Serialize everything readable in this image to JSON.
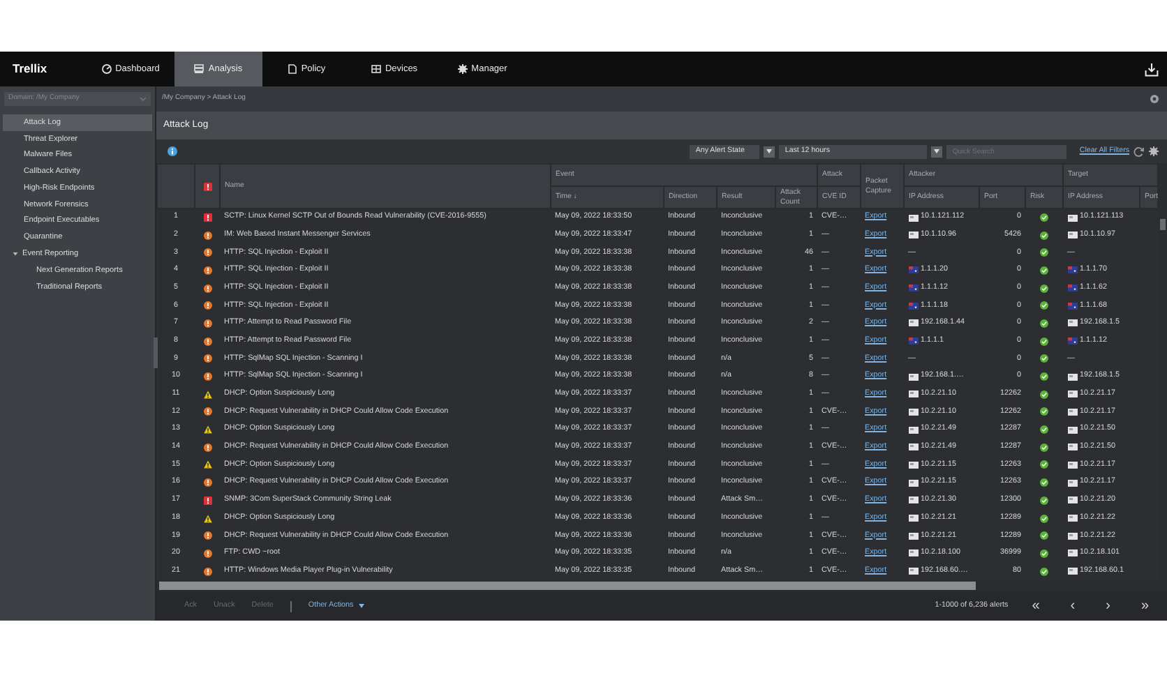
{
  "nav": {
    "logo": "Trellix",
    "tabs": [
      {
        "label": "Dashboard",
        "selected": false
      },
      {
        "label": "Analysis",
        "selected": true
      },
      {
        "label": "Policy",
        "selected": false
      },
      {
        "label": "Devices",
        "selected": false
      },
      {
        "label": "Manager",
        "selected": false
      }
    ]
  },
  "sidebar": {
    "domain_select": "Domain: /My Company",
    "items": [
      {
        "label": "Attack Log",
        "selected": true
      },
      {
        "label": "Threat Explorer",
        "selected": false
      },
      {
        "label": "Malware Files",
        "selected": false
      },
      {
        "label": "Callback Activity",
        "selected": false
      },
      {
        "label": "High-Risk Endpoints",
        "selected": false
      },
      {
        "label": "Network Forensics",
        "selected": false
      },
      {
        "label": "Endpoint Executables",
        "selected": false
      },
      {
        "label": "Quarantine",
        "selected": false
      },
      {
        "label": "Event Reporting",
        "selected": false,
        "expanded": true,
        "children": [
          {
            "label": "Next Generation Reports",
            "selected": false
          },
          {
            "label": "Traditional Reports",
            "selected": false
          }
        ]
      }
    ]
  },
  "breadcrumb": "/My Company > Attack Log",
  "title": "Attack Log",
  "toolbar": {
    "alert_state": "Any Alert State",
    "time_range": "Last 12 hours",
    "search_placeholder": "Quick Search",
    "clear_filters": "Clear All Filters"
  },
  "table": {
    "header": [
      {
        "kind": "single",
        "label": "Name"
      },
      {
        "kind": "group",
        "label": "Event",
        "columns": [
          "Time ↓",
          "Direction",
          "Result",
          "Attack Count"
        ]
      },
      {
        "kind": "group",
        "label": "Attack",
        "columns": [
          "CVE ID"
        ]
      },
      {
        "kind": "single",
        "label": "Packet Capture"
      },
      {
        "kind": "group",
        "label": "Attacker",
        "columns": [
          "IP Address",
          "Port",
          "Risk"
        ]
      },
      {
        "kind": "group",
        "label": "Target",
        "columns": [
          "IP Address",
          "Port"
        ]
      }
    ],
    "rows": [
      {
        "num": "1",
        "severity": {
          "kind": "high"
        },
        "name": "SCTP: Linux Kernel SCTP Out of Bounds Read Vulnerability (CVE-2016-9555)",
        "time": "May 09, 2022 18:33:50",
        "direction": "Inbound",
        "result": "Inconclusive",
        "attack_count": "1",
        "cve_id": "CVE-…",
        "packet_capture": "Export",
        "attacker_ip": "10.1.121.112",
        "attacker_flag": {
          "kind": "generic"
        },
        "attacker_port": "0",
        "target_ip": "10.1.121.113",
        "target_flag": {
          "kind": "generic"
        }
      },
      {
        "num": "2",
        "severity": {
          "kind": "medium"
        },
        "name": "IM: Web Based Instant Messenger Services",
        "time": "May 09, 2022 18:33:47",
        "direction": "Inbound",
        "result": "Inconclusive",
        "attack_count": "1",
        "cve_id": "—",
        "packet_capture": "Export",
        "attacker_ip": "10.1.10.96",
        "attacker_flag": {
          "kind": "generic"
        },
        "attacker_port": "5426",
        "target_ip": "10.1.10.97",
        "target_flag": {
          "kind": "generic"
        }
      },
      {
        "num": "3",
        "severity": {
          "kind": "medium"
        },
        "name": "HTTP: SQL Injection - Exploit II",
        "time": "May 09, 2022 18:33:38",
        "direction": "Inbound",
        "result": "Inconclusive",
        "attack_count": "46",
        "cve_id": "—",
        "packet_capture": "Export",
        "attacker_ip": "—",
        "attacker_port": "0",
        "target_ip": "—"
      },
      {
        "num": "4",
        "severity": {
          "kind": "medium"
        },
        "name": "HTTP: SQL Injection - Exploit II",
        "time": "May 09, 2022 18:33:38",
        "direction": "Inbound",
        "result": "Inconclusive",
        "attack_count": "1",
        "cve_id": "—",
        "packet_capture": "Export",
        "attacker_ip": "1.1.1.20",
        "attacker_flag": {
          "kind": "au"
        },
        "attacker_port": "0",
        "target_ip": "1.1.1.70",
        "target_flag": {
          "kind": "au"
        }
      },
      {
        "num": "5",
        "severity": {
          "kind": "medium"
        },
        "name": "HTTP: SQL Injection - Exploit II",
        "time": "May 09, 2022 18:33:38",
        "direction": "Inbound",
        "result": "Inconclusive",
        "attack_count": "1",
        "cve_id": "—",
        "packet_capture": "Export",
        "attacker_ip": "1.1.1.12",
        "attacker_flag": {
          "kind": "au"
        },
        "attacker_port": "0",
        "target_ip": "1.1.1.62",
        "target_flag": {
          "kind": "au"
        }
      },
      {
        "num": "6",
        "severity": {
          "kind": "medium"
        },
        "name": "HTTP: SQL Injection - Exploit II",
        "time": "May 09, 2022 18:33:38",
        "direction": "Inbound",
        "result": "Inconclusive",
        "attack_count": "1",
        "cve_id": "—",
        "packet_capture": "Export",
        "attacker_ip": "1.1.1.18",
        "attacker_flag": {
          "kind": "au"
        },
        "attacker_port": "0",
        "target_ip": "1.1.1.68",
        "target_flag": {
          "kind": "au"
        }
      },
      {
        "num": "7",
        "severity": {
          "kind": "medium"
        },
        "name": "HTTP: Attempt to Read Password File",
        "time": "May 09, 2022 18:33:38",
        "direction": "Inbound",
        "result": "Inconclusive",
        "attack_count": "2",
        "cve_id": "—",
        "packet_capture": "Export",
        "attacker_ip": "192.168.1.44",
        "attacker_flag": {
          "kind": "generic"
        },
        "attacker_port": "0",
        "target_ip": "192.168.1.5",
        "target_flag": {
          "kind": "generic"
        }
      },
      {
        "num": "8",
        "severity": {
          "kind": "medium"
        },
        "name": "HTTP: Attempt to Read Password File",
        "time": "May 09, 2022 18:33:38",
        "direction": "Inbound",
        "result": "Inconclusive",
        "attack_count": "1",
        "cve_id": "—",
        "packet_capture": "Export",
        "attacker_ip": "1.1.1.1",
        "attacker_flag": {
          "kind": "au"
        },
        "attacker_port": "0",
        "target_ip": "1.1.1.12",
        "target_flag": {
          "kind": "au"
        }
      },
      {
        "num": "9",
        "severity": {
          "kind": "medium"
        },
        "name": "HTTP: SqlMap SQL Injection - Scanning I",
        "time": "May 09, 2022 18:33:38",
        "direction": "Inbound",
        "result": "n/a",
        "attack_count": "5",
        "cve_id": "—",
        "packet_capture": "Export",
        "attacker_ip": "—",
        "attacker_port": "0",
        "target_ip": "—"
      },
      {
        "num": "10",
        "severity": {
          "kind": "medium"
        },
        "name": "HTTP: SqlMap SQL Injection - Scanning I",
        "time": "May 09, 2022 18:33:38",
        "direction": "Inbound",
        "result": "n/a",
        "attack_count": "8",
        "cve_id": "—",
        "packet_capture": "Export",
        "attacker_ip": "192.168.1.…",
        "attacker_flag": {
          "kind": "generic"
        },
        "attacker_port": "0",
        "target_ip": "192.168.1.5",
        "target_flag": {
          "kind": "generic"
        }
      },
      {
        "num": "11",
        "severity": {
          "kind": "low"
        },
        "name": "DHCP: Option Suspiciously Long",
        "time": "May 09, 2022 18:33:37",
        "direction": "Inbound",
        "result": "Inconclusive",
        "attack_count": "1",
        "cve_id": "—",
        "packet_capture": "Export",
        "attacker_ip": "10.2.21.10",
        "attacker_flag": {
          "kind": "generic"
        },
        "attacker_port": "12262",
        "target_ip": "10.2.21.17",
        "target_flag": {
          "kind": "generic"
        }
      },
      {
        "num": "12",
        "severity": {
          "kind": "medium"
        },
        "name": "DHCP: Request Vulnerability in DHCP Could Allow Code Execution",
        "time": "May 09, 2022 18:33:37",
        "direction": "Inbound",
        "result": "Inconclusive",
        "attack_count": "1",
        "cve_id": "CVE-…",
        "packet_capture": "Export",
        "attacker_ip": "10.2.21.10",
        "attacker_flag": {
          "kind": "generic"
        },
        "attacker_port": "12262",
        "target_ip": "10.2.21.17",
        "target_flag": {
          "kind": "generic"
        }
      },
      {
        "num": "13",
        "severity": {
          "kind": "low"
        },
        "name": "DHCP: Option Suspiciously Long",
        "time": "May 09, 2022 18:33:37",
        "direction": "Inbound",
        "result": "Inconclusive",
        "attack_count": "1",
        "cve_id": "—",
        "packet_capture": "Export",
        "attacker_ip": "10.2.21.49",
        "attacker_flag": {
          "kind": "generic"
        },
        "attacker_port": "12287",
        "target_ip": "10.2.21.50",
        "target_flag": {
          "kind": "generic"
        }
      },
      {
        "num": "14",
        "severity": {
          "kind": "medium"
        },
        "name": "DHCP: Request Vulnerability in DHCP Could Allow Code Execution",
        "time": "May 09, 2022 18:33:37",
        "direction": "Inbound",
        "result": "Inconclusive",
        "attack_count": "1",
        "cve_id": "CVE-…",
        "packet_capture": "Export",
        "attacker_ip": "10.2.21.49",
        "attacker_flag": {
          "kind": "generic"
        },
        "attacker_port": "12287",
        "target_ip": "10.2.21.50",
        "target_flag": {
          "kind": "generic"
        }
      },
      {
        "num": "15",
        "severity": {
          "kind": "low"
        },
        "name": "DHCP: Option Suspiciously Long",
        "time": "May 09, 2022 18:33:37",
        "direction": "Inbound",
        "result": "Inconclusive",
        "attack_count": "1",
        "cve_id": "—",
        "packet_capture": "Export",
        "attacker_ip": "10.2.21.15",
        "attacker_flag": {
          "kind": "generic"
        },
        "attacker_port": "12263",
        "target_ip": "10.2.21.17",
        "target_flag": {
          "kind": "generic"
        }
      },
      {
        "num": "16",
        "severity": {
          "kind": "medium"
        },
        "name": "DHCP: Request Vulnerability in DHCP Could Allow Code Execution",
        "time": "May 09, 2022 18:33:37",
        "direction": "Inbound",
        "result": "Inconclusive",
        "attack_count": "1",
        "cve_id": "CVE-…",
        "packet_capture": "Export",
        "attacker_ip": "10.2.21.15",
        "attacker_flag": {
          "kind": "generic"
        },
        "attacker_port": "12263",
        "target_ip": "10.2.21.17",
        "target_flag": {
          "kind": "generic"
        }
      },
      {
        "num": "17",
        "severity": {
          "kind": "high"
        },
        "name": "SNMP: 3Com SuperStack Community String Leak",
        "time": "May 09, 2022 18:33:36",
        "direction": "Inbound",
        "result": "Attack Sm…",
        "attack_count": "1",
        "cve_id": "CVE-…",
        "packet_capture": "Export",
        "attacker_ip": "10.2.21.30",
        "attacker_flag": {
          "kind": "generic"
        },
        "attacker_port": "12300",
        "target_ip": "10.2.21.20",
        "target_flag": {
          "kind": "generic"
        }
      },
      {
        "num": "18",
        "severity": {
          "kind": "low"
        },
        "name": "DHCP: Option Suspiciously Long",
        "time": "May 09, 2022 18:33:36",
        "direction": "Inbound",
        "result": "Inconclusive",
        "attack_count": "1",
        "cve_id": "—",
        "packet_capture": "Export",
        "attacker_ip": "10.2.21.21",
        "attacker_flag": {
          "kind": "generic"
        },
        "attacker_port": "12289",
        "target_ip": "10.2.21.22",
        "target_flag": {
          "kind": "generic"
        }
      },
      {
        "num": "19",
        "severity": {
          "kind": "medium"
        },
        "name": "DHCP: Request Vulnerability in DHCP Could Allow Code Execution",
        "time": "May 09, 2022 18:33:36",
        "direction": "Inbound",
        "result": "Inconclusive",
        "attack_count": "1",
        "cve_id": "CVE-…",
        "packet_capture": "Export",
        "attacker_ip": "10.2.21.21",
        "attacker_flag": {
          "kind": "generic"
        },
        "attacker_port": "12289",
        "target_ip": "10.2.21.22",
        "target_flag": {
          "kind": "generic"
        }
      },
      {
        "num": "20",
        "severity": {
          "kind": "medium"
        },
        "name": "FTP: CWD ~root",
        "time": "May 09, 2022 18:33:35",
        "direction": "Inbound",
        "result": "n/a",
        "attack_count": "1",
        "cve_id": "CVE-…",
        "packet_capture": "Export",
        "attacker_ip": "10.2.18.100",
        "attacker_flag": {
          "kind": "generic"
        },
        "attacker_port": "36999",
        "target_ip": "10.2.18.101",
        "target_flag": {
          "kind": "generic"
        }
      },
      {
        "num": "21",
        "severity": {
          "kind": "medium"
        },
        "name": "HTTP: Windows Media Player Plug-in Vulnerability",
        "time": "May 09, 2022 18:33:35",
        "direction": "Inbound",
        "result": "Attack Sm…",
        "attack_count": "1",
        "cve_id": "CVE-…",
        "packet_capture": "Export",
        "attacker_ip": "192.168.60.…",
        "attacker_flag": {
          "kind": "generic"
        },
        "attacker_port": "80",
        "target_ip": "192.168.60.1",
        "target_flag": {
          "kind": "generic"
        }
      }
    ]
  },
  "footer": {
    "actions": [
      {
        "label": "Ack",
        "disabled": true
      },
      {
        "label": "Unack",
        "disabled": true
      },
      {
        "label": "Delete",
        "disabled": true
      }
    ],
    "other_actions": "Other Actions",
    "count": "1-1000 of 6,236 alerts",
    "pager": [
      "«",
      "‹",
      "›",
      "»"
    ]
  }
}
